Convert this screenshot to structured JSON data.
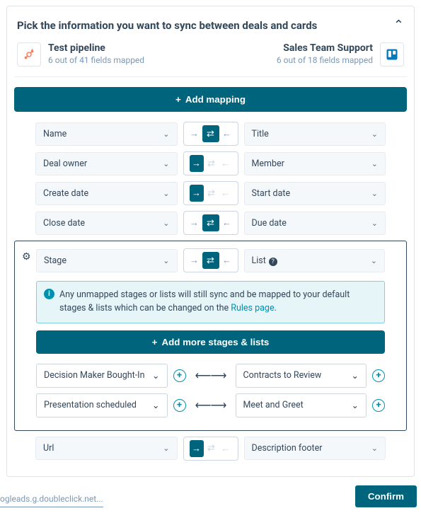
{
  "header": {
    "title": "Pick the information you want to sync between deals and cards"
  },
  "left_source": {
    "name": "Test pipeline",
    "sub": "6 out of 41 fields mapped"
  },
  "right_source": {
    "name": "Sales Team Support",
    "sub": "6 out of 18 fields mapped"
  },
  "add_mapping_label": "Add mapping",
  "mappings": [
    {
      "left": "Name",
      "right": "Title",
      "mode": "two-way"
    },
    {
      "left": "Deal owner",
      "right": "Member",
      "mode": "one-way"
    },
    {
      "left": "Create date",
      "right": "Start date",
      "mode": "one-way"
    },
    {
      "left": "Close date",
      "right": "Due date",
      "mode": "two-way"
    }
  ],
  "stage_mapping": {
    "left": "Stage",
    "right": "List",
    "mode": "two-way",
    "info_text_a": "Any unmapped stages or lists will still sync and be mapped to your default stages & lists which can be changed on the ",
    "info_link": "Rules page",
    "info_text_b": ".",
    "add_more_label": "Add more stages & lists",
    "sub_mappings": [
      {
        "left": "Decision Maker Bought-In",
        "right": "Contracts to Review"
      },
      {
        "left": "Presentation scheduled",
        "right": "Meet and Greet"
      }
    ]
  },
  "tail_mapping": {
    "left": "Url",
    "right": "Description footer",
    "mode": "one-way"
  },
  "footer_text": "ogleads.g.doubleclick.net...",
  "confirm_label": "Confirm"
}
